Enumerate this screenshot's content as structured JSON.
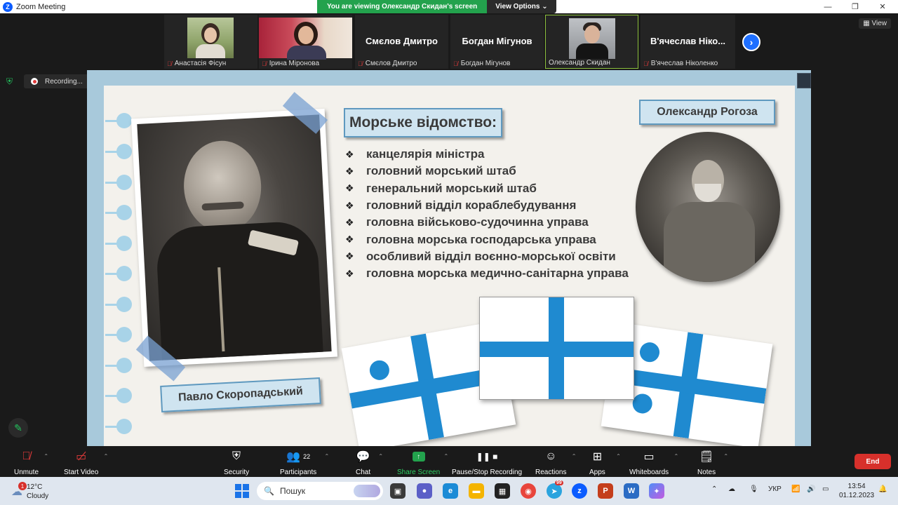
{
  "window": {
    "app_title": "Zoom Meeting",
    "viewing_banner": "You are viewing Олександр Скидан's screen",
    "view_options": "View Options",
    "view_label": "View",
    "min_icon": "—",
    "max_icon": "❐",
    "close_icon": "✕"
  },
  "gallery": {
    "participants": [
      {
        "name": "Анастасія Фісун",
        "big_name": "",
        "has_video": true,
        "muted": true
      },
      {
        "name": "Ірина Міронова",
        "big_name": "",
        "has_video": true,
        "muted": true
      },
      {
        "name": "Смєлов Дмитро",
        "big_name": "Смєлов Дмитро",
        "has_video": false,
        "muted": true
      },
      {
        "name": "Богдан Мігунов",
        "big_name": "Богдан Мігунов",
        "has_video": false,
        "muted": true
      },
      {
        "name": "Олександр Скидан",
        "big_name": "",
        "has_video": true,
        "muted": false
      },
      {
        "name": "В'ячеслав Ніколенко",
        "big_name": "В'ячеслав Ніко...",
        "has_video": false,
        "muted": true
      }
    ],
    "next_icon": "›"
  },
  "recording": {
    "label": "Recording...",
    "pause_icon": "❚❚",
    "stop_icon": "■"
  },
  "slide": {
    "heading": "Морське відомство:",
    "items": [
      "канцелярія міністра",
      "головний морський штаб",
      "генеральний морський штаб",
      "головний відділ кораблебудування",
      "головна військово-судочинна управа",
      "головна морська господарська управа",
      "особливий відділ воєнно-морської освіти",
      "головна морська медично-санітарна управа"
    ],
    "bullet": "❖",
    "left_caption": "Павло Скоропадський",
    "right_caption": "Олександр Рогоза",
    "flag_color": "#1f8ad0"
  },
  "toolbar": {
    "unmute": "Unmute",
    "start_video": "Start Video",
    "security": "Security",
    "participants": "Participants",
    "participants_count": "22",
    "chat": "Chat",
    "share_screen": "Share Screen",
    "pause_stop_recording": "Pause/Stop Recording",
    "reactions": "Reactions",
    "apps": "Apps",
    "whiteboards": "Whiteboards",
    "notes": "Notes",
    "end": "End"
  },
  "taskbar": {
    "temperature": "12°C",
    "condition": "Cloudy",
    "weather_badge": "1",
    "search_placeholder": "Пошук",
    "language": "УКР",
    "time": "13:54",
    "date": "01.12.2023",
    "telegram_badge": "99"
  }
}
